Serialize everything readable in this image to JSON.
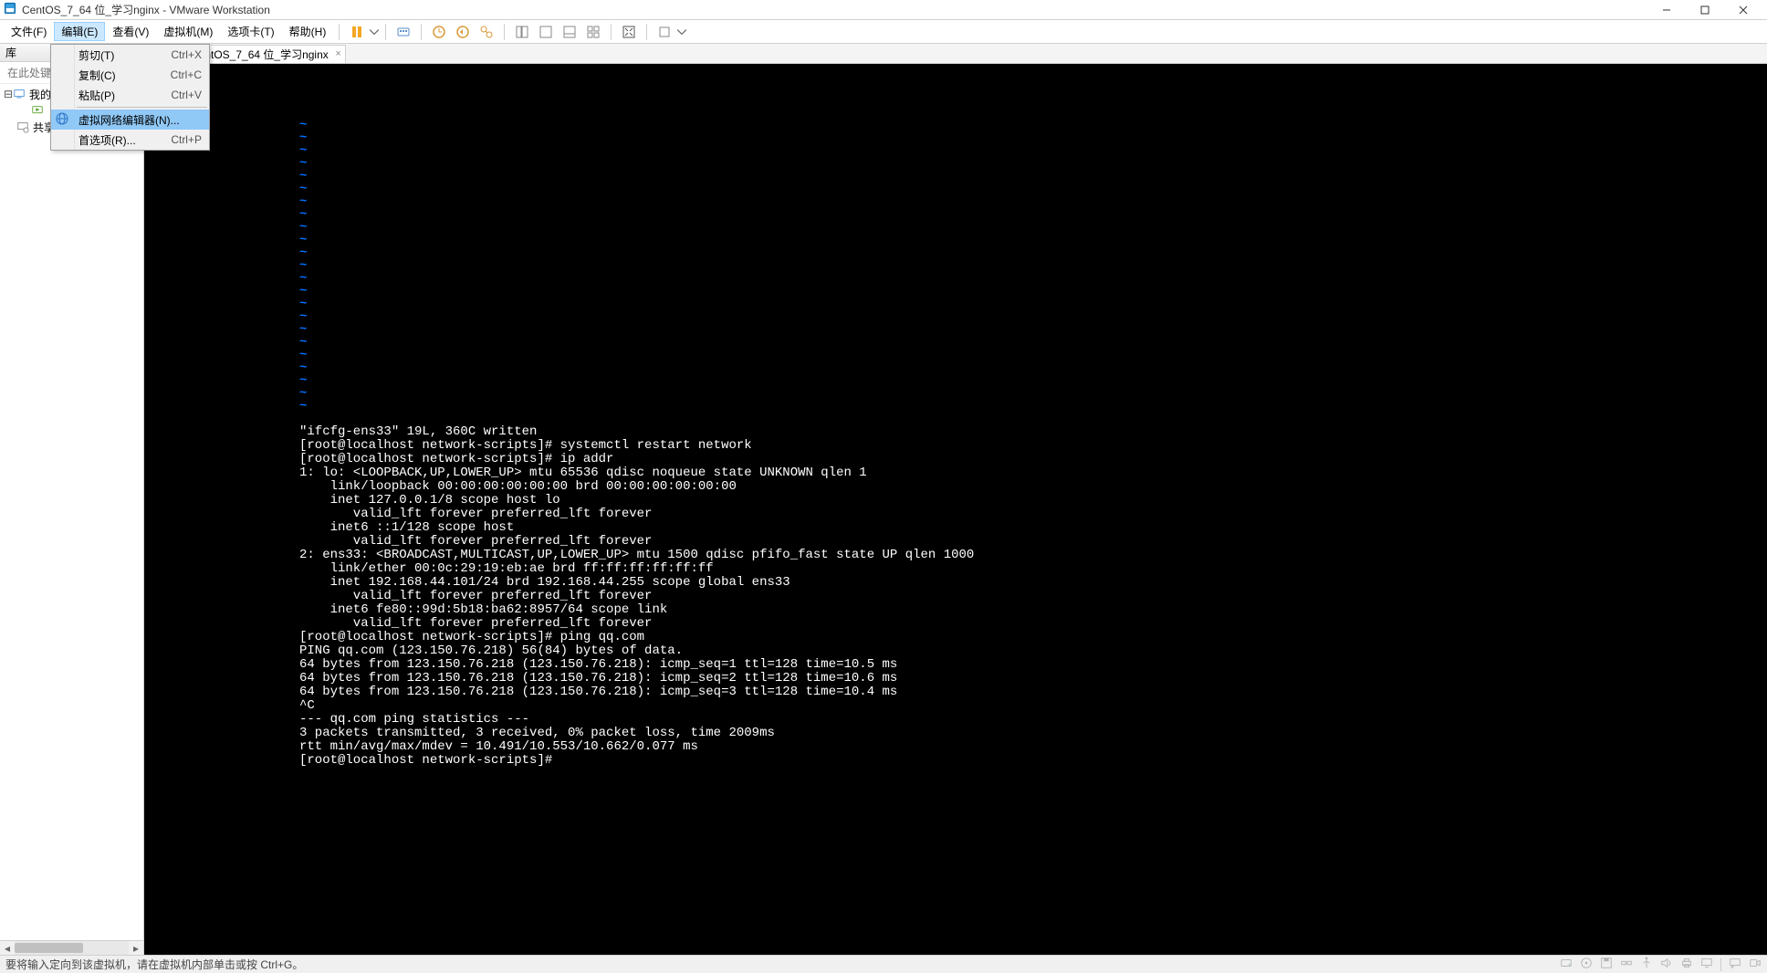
{
  "title": "CentOS_7_64 位_学习nginx - VMware Workstation",
  "menubar": {
    "file": "文件(F)",
    "edit": "编辑(E)",
    "view": "查看(V)",
    "vm": "虚拟机(M)",
    "tabs": "选项卡(T)",
    "help": "帮助(H)"
  },
  "edit_menu": {
    "cut": "剪切(T)",
    "cut_sc": "Ctrl+X",
    "copy": "复制(C)",
    "copy_sc": "Ctrl+C",
    "paste": "粘贴(P)",
    "paste_sc": "Ctrl+V",
    "vne": "虚拟网络编辑器(N)...",
    "prefs": "首选项(R)...",
    "prefs_sc": "Ctrl+P"
  },
  "library": {
    "header": "库",
    "search_ph": "在此处键入内容进行搜索",
    "node_mycomp": "我的计算机",
    "node_shared": "共享的虚拟机"
  },
  "tab": {
    "name": "CentOS_7_64 位_学习nginx"
  },
  "tilde": "~",
  "terminal_lines": [
    "\"ifcfg-ens33\" 19L, 360C written",
    "[root@localhost network-scripts]# systemctl restart network",
    "[root@localhost network-scripts]# ip addr",
    "1: lo: <LOOPBACK,UP,LOWER_UP> mtu 65536 qdisc noqueue state UNKNOWN qlen 1",
    "    link/loopback 00:00:00:00:00:00 brd 00:00:00:00:00:00",
    "    inet 127.0.0.1/8 scope host lo",
    "       valid_lft forever preferred_lft forever",
    "    inet6 ::1/128 scope host",
    "       valid_lft forever preferred_lft forever",
    "2: ens33: <BROADCAST,MULTICAST,UP,LOWER_UP> mtu 1500 qdisc pfifo_fast state UP qlen 1000",
    "    link/ether 00:0c:29:19:eb:ae brd ff:ff:ff:ff:ff:ff",
    "    inet 192.168.44.101/24 brd 192.168.44.255 scope global ens33",
    "       valid_lft forever preferred_lft forever",
    "    inet6 fe80::99d:5b18:ba62:8957/64 scope link",
    "       valid_lft forever preferred_lft forever",
    "[root@localhost network-scripts]# ping qq.com",
    "PING qq.com (123.150.76.218) 56(84) bytes of data.",
    "64 bytes from 123.150.76.218 (123.150.76.218): icmp_seq=1 ttl=128 time=10.5 ms",
    "64 bytes from 123.150.76.218 (123.150.76.218): icmp_seq=2 ttl=128 time=10.6 ms",
    "64 bytes from 123.150.76.218 (123.150.76.218): icmp_seq=3 ttl=128 time=10.4 ms",
    "^C",
    "--- qq.com ping statistics ---",
    "3 packets transmitted, 3 received, 0% packet loss, time 2009ms",
    "rtt min/avg/max/mdev = 10.491/10.553/10.662/0.077 ms",
    "[root@localhost network-scripts]#"
  ],
  "statusbar": {
    "text": "要将输入定向到该虚拟机，请在虚拟机内部单击或按 Ctrl+G。"
  }
}
